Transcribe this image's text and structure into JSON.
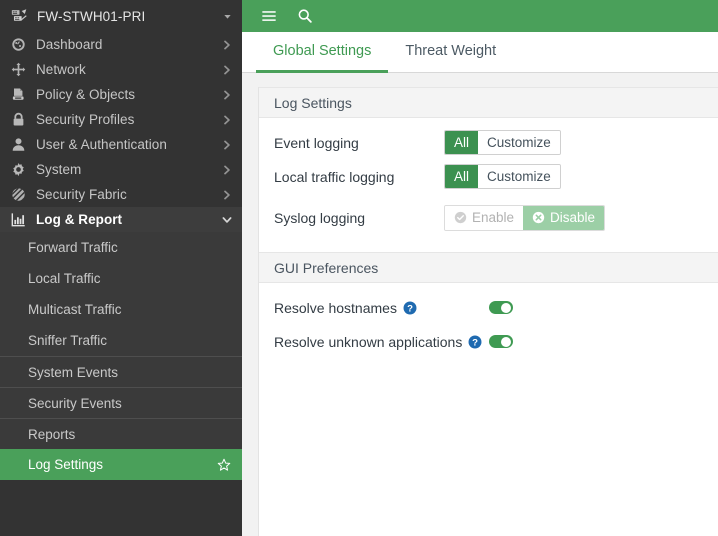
{
  "sidebar": {
    "device": {
      "name": "FW-STWH01-PRI",
      "icon": "device-switch-icon",
      "caret": "chevron-down-icon"
    },
    "items": [
      {
        "label": "Dashboard",
        "icon": "dashboard-gauge-icon",
        "expandable": true,
        "expanded": false
      },
      {
        "label": "Network",
        "icon": "network-arrows-icon",
        "expandable": true,
        "expanded": false
      },
      {
        "label": "Policy & Objects",
        "icon": "policy-document-icon",
        "expandable": true,
        "expanded": false
      },
      {
        "label": "Security Profiles",
        "icon": "lock-icon",
        "expandable": true,
        "expanded": false
      },
      {
        "label": "User & Authentication",
        "icon": "user-icon",
        "expandable": true,
        "expanded": false
      },
      {
        "label": "System",
        "icon": "gear-icon",
        "expandable": true,
        "expanded": false
      },
      {
        "label": "Security Fabric",
        "icon": "fabric-sphere-icon",
        "expandable": true,
        "expanded": false
      },
      {
        "label": "Log & Report",
        "icon": "bar-chart-icon",
        "expandable": true,
        "expanded": true
      }
    ],
    "sub_items": [
      {
        "label": "Forward Traffic",
        "active": false,
        "separator": false,
        "starred": false
      },
      {
        "label": "Local Traffic",
        "active": false,
        "separator": false,
        "starred": false
      },
      {
        "label": "Multicast Traffic",
        "active": false,
        "separator": false,
        "starred": false
      },
      {
        "label": "Sniffer Traffic",
        "active": false,
        "separator": false,
        "starred": false
      },
      {
        "label": "System Events",
        "active": false,
        "separator": true,
        "starred": false
      },
      {
        "label": "Security Events",
        "active": false,
        "separator": true,
        "starred": false
      },
      {
        "label": "Reports",
        "active": false,
        "separator": true,
        "starred": false
      },
      {
        "label": "Log Settings",
        "active": true,
        "separator": false,
        "starred": true
      }
    ]
  },
  "topbar": {
    "menu_icon": "hamburger-menu-icon",
    "search_icon": "search-icon"
  },
  "tabs": [
    {
      "label": "Global Settings",
      "active": true
    },
    {
      "label": "Threat Weight",
      "active": false
    }
  ],
  "sections": {
    "log_settings": {
      "title": "Log Settings",
      "event_logging": {
        "label": "Event logging",
        "options": [
          "All",
          "Customize"
        ],
        "selected": "All"
      },
      "local_traffic_logging": {
        "label": "Local traffic logging",
        "options": [
          "All",
          "Customize"
        ],
        "selected": "All"
      },
      "syslog_logging": {
        "label": "Syslog logging",
        "options": [
          "Enable",
          "Disable"
        ],
        "selected": "Disable",
        "enable_icon": "check-circle-icon",
        "disable_icon": "x-circle-icon"
      }
    },
    "gui_preferences": {
      "title": "GUI Preferences",
      "resolve_hostnames": {
        "label": "Resolve hostnames",
        "help_icon": "help-circle-icon",
        "value": "on"
      },
      "resolve_unknown_applications": {
        "label": "Resolve unknown applications",
        "help_icon": "help-circle-icon",
        "value": "on"
      }
    }
  },
  "colors": {
    "accent_green": "#4aa05a",
    "selected_green": "#3c9150",
    "sidebar_bg": "#333333",
    "submenu_bg": "#3a3a3a",
    "help_blue": "#1f6ab0"
  }
}
